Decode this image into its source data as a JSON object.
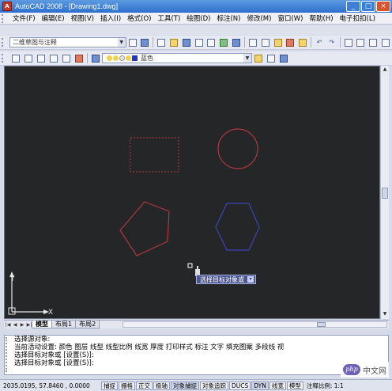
{
  "window": {
    "title": "AutoCAD 2008 - [Drawing1.dwg]",
    "controls": {
      "minimize": "_",
      "maximize": "□",
      "close": "×"
    }
  },
  "menu": [
    "文件(F)",
    "编辑(E)",
    "视图(V)",
    "插入(I)",
    "格式(O)",
    "工具(T)",
    "绘图(D)",
    "标注(N)",
    "修改(M)",
    "窗口(W)",
    "帮助(H)",
    "电子扣扣(L)"
  ],
  "toolbar1": {
    "workspace_combo": "二维草图与注释"
  },
  "toolbar2": {
    "layer_color_label": "蓝色",
    "layer_colors": [
      "#f2d24a",
      "#f2d24a",
      "#e4e4e4",
      "#f2d24a",
      "#2233cc"
    ]
  },
  "canvas": {
    "background": "#252628",
    "tooltip": "选择目标对象或",
    "ucs": {
      "x": "X",
      "y": "Y"
    }
  },
  "tabs": {
    "items": [
      "模型",
      "布局1",
      "布局2"
    ],
    "active": 0
  },
  "command": {
    "lines": [
      "选择源对象:",
      "当前活动设置: 颜色 图层 线型 线型比例 线宽 厚度 打印样式 标注 文字 填充图案 多段线 视",
      "选择目标对象或 [设置(S)]:",
      "选择目标对象或 [设置(S)]:"
    ]
  },
  "status": {
    "coords": "2035.0195, 57.8460 , 0.0000",
    "buttons": [
      {
        "label": "捕捉",
        "on": false
      },
      {
        "label": "栅格",
        "on": false
      },
      {
        "label": "正交",
        "on": false
      },
      {
        "label": "极轴",
        "on": false
      },
      {
        "label": "对象捕捉",
        "on": true
      },
      {
        "label": "对象追踪",
        "on": false
      },
      {
        "label": "DUCS",
        "on": false
      },
      {
        "label": "DYN",
        "on": true
      },
      {
        "label": "线宽",
        "on": false
      },
      {
        "label": "模型",
        "on": false
      }
    ],
    "scale": "注释比例: 1:1"
  },
  "watermark": {
    "badge": "php",
    "text": "中文网"
  }
}
